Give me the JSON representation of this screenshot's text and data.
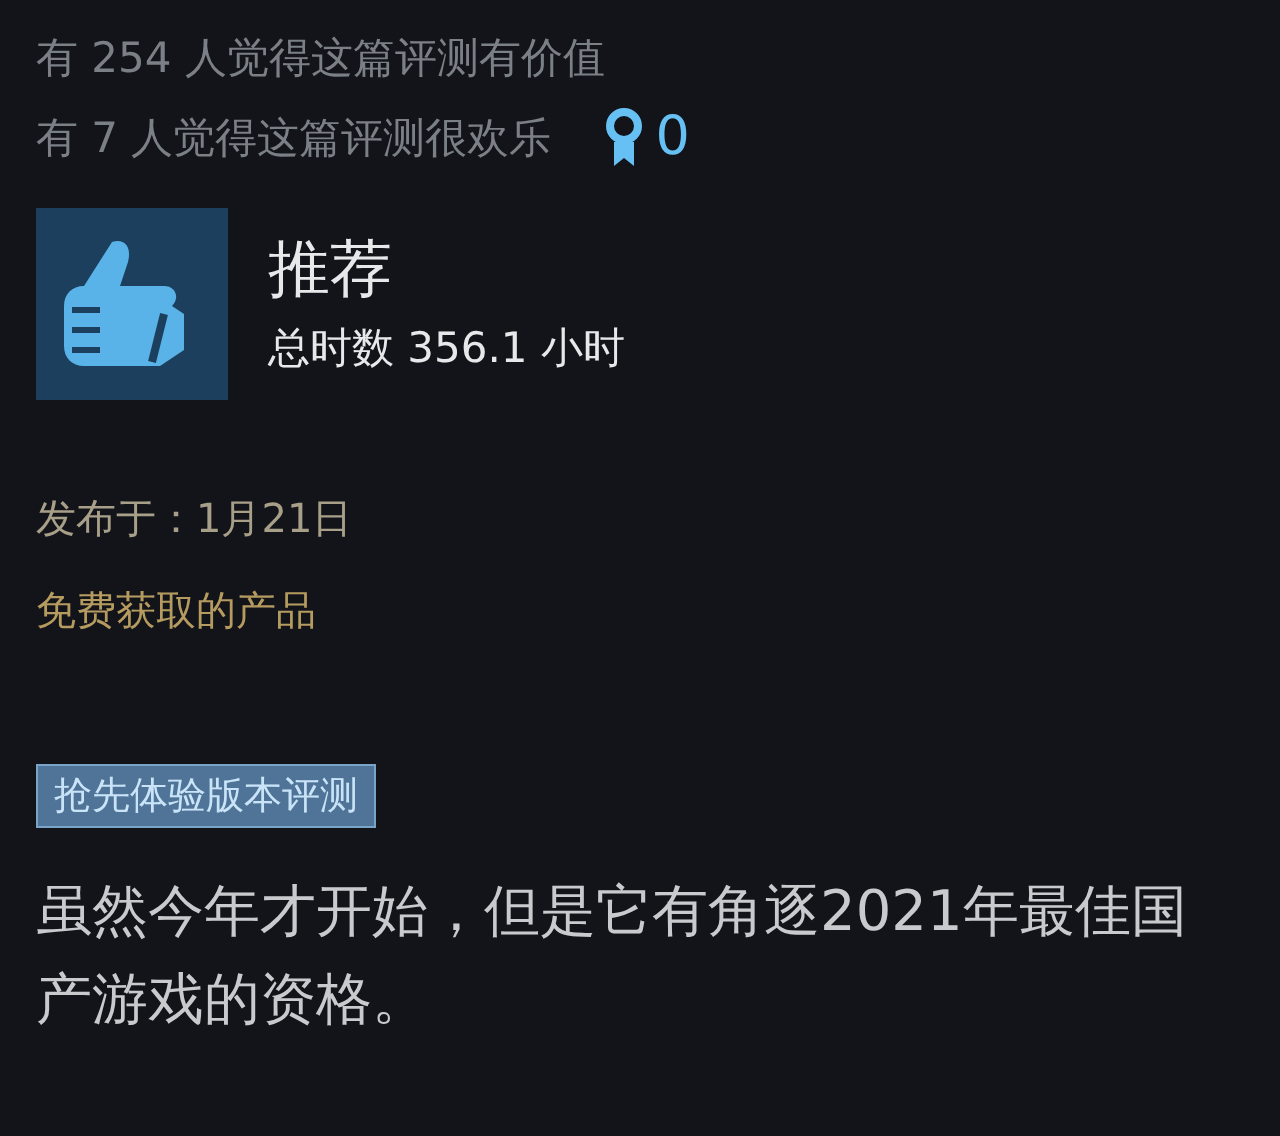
{
  "votes": {
    "helpful": "有 254 人觉得这篇评测有价值",
    "funny": "有 7 人觉得这篇评测很欢乐",
    "awards": "0"
  },
  "verdict": {
    "label": "推荐",
    "recommended": true,
    "hours": "总时数 356.1 小时"
  },
  "posted": "发布于：1月21日",
  "free_product": "免费获取的产品",
  "tag": "抢先体验版本评测",
  "review": "虽然今年才开始，但是它有角逐2021年最佳国产游戏的资格。"
}
